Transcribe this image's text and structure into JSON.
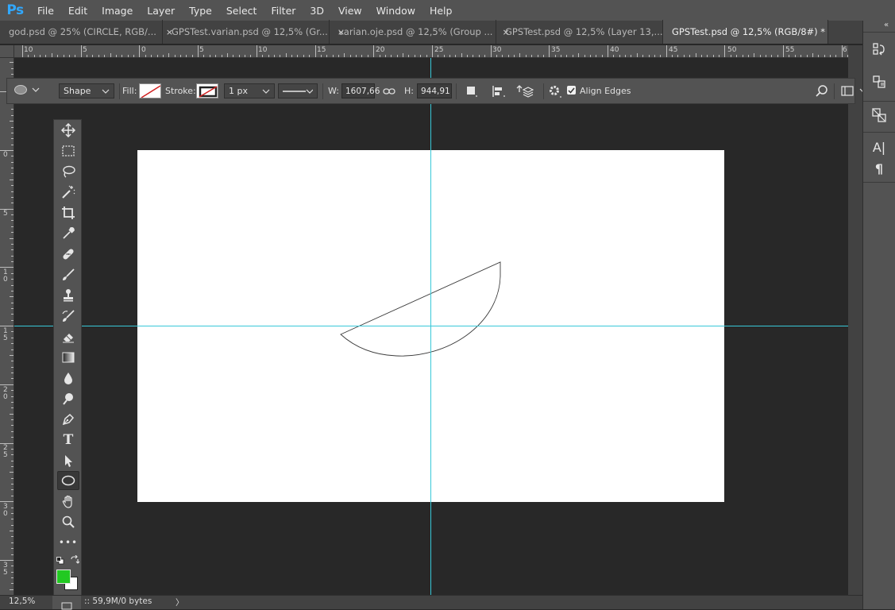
{
  "app": {
    "logo": "Ps"
  },
  "menu": [
    "File",
    "Edit",
    "Image",
    "Layer",
    "Type",
    "Select",
    "Filter",
    "3D",
    "View",
    "Window",
    "Help"
  ],
  "tabs": [
    {
      "label": "god.psd @ 25% (CIRCLE, RGB/...",
      "active": false
    },
    {
      "label": "GPSTest.varian.psd @ 12,5% (Gr...",
      "active": false
    },
    {
      "label": "varian.oje.psd @ 12,5% (Group ...",
      "active": false
    },
    {
      "label": "GPSTest.psd @ 12,5% (Layer 13,...",
      "active": false
    },
    {
      "label": "GPSTest.psd @ 12,5% (RGB/8#) *",
      "active": true
    }
  ],
  "tab_close": "×",
  "ruler": {
    "h_labels": [
      "10",
      "5",
      "0",
      "5",
      "10",
      "15",
      "20",
      "25",
      "30",
      "35",
      "40",
      "45",
      "50",
      "55",
      "6"
    ],
    "v_labels": [
      "0",
      "5",
      "1\n0",
      "1\n5",
      "2\n0",
      "2\n5",
      "3\n0",
      "3\n5"
    ]
  },
  "options": {
    "mode": "Shape",
    "fill_label": "Fill:",
    "stroke_label": "Stroke:",
    "stroke_width": "1 px",
    "w_label": "W:",
    "w_value": "1607,66",
    "h_label": "H:",
    "h_value": "944,91 p",
    "align_edges": "Align Edges"
  },
  "tools": [
    "move-tool",
    "marquee-tool",
    "lasso-tool",
    "magic-wand-tool",
    "crop-tool",
    "eyedropper-tool",
    "healing-brush-tool",
    "brush-tool",
    "stamp-tool",
    "history-brush-tool",
    "eraser-tool",
    "gradient-tool",
    "blur-tool",
    "dodge-tool",
    "pen-tool",
    "type-tool",
    "path-selection-tool",
    "ellipse-tool",
    "hand-tool",
    "zoom-tool",
    "more-tools"
  ],
  "type_tool_glyph": "T",
  "more_glyph": "•••",
  "colors": {
    "foreground": "#22c922",
    "background": "#ffffff",
    "guide": "#38c8d8"
  },
  "right_panel": {
    "collapse": "«",
    "char_glyph": "A|",
    "para_glyph": "¶"
  },
  "status": {
    "zoom": "12,5%",
    "doc_info": ":: 59,9M/0 bytes",
    "arrow": "〉"
  }
}
